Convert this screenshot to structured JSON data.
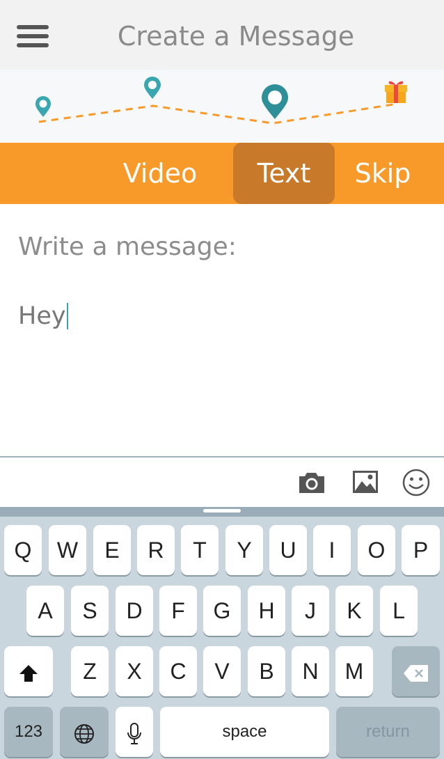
{
  "header": {
    "title": "Create a Message",
    "menu_icon": "hamburger-menu-icon"
  },
  "progress": {
    "steps": [
      "location-pin-icon",
      "location-pin-icon",
      "location-pin-icon-current",
      "gift-icon"
    ],
    "colors": {
      "pin": "#3aa7b0",
      "path": "#f89a29",
      "gift": "#f7a51d"
    }
  },
  "tabs": [
    {
      "label": "Video"
    },
    {
      "label": "Text",
      "selected": true
    },
    {
      "label": "Skip"
    }
  ],
  "compose": {
    "label": "Write a message:",
    "value": "Hey"
  },
  "attachments": {
    "icons": [
      "camera-icon",
      "image-icon",
      "emoji-icon"
    ]
  },
  "keyboard": {
    "row1": [
      "Q",
      "W",
      "E",
      "R",
      "T",
      "Y",
      "U",
      "I",
      "O",
      "P"
    ],
    "row2": [
      "A",
      "S",
      "D",
      "F",
      "G",
      "H",
      "J",
      "K",
      "L"
    ],
    "row3": [
      "Z",
      "X",
      "C",
      "V",
      "B",
      "N",
      "M"
    ],
    "numbers_label": "123",
    "space_label": "space",
    "return_label": "return"
  },
  "colors": {
    "accent": "#f89a29",
    "tab_selected": "#c87929",
    "teal": "#3aa7b0"
  }
}
